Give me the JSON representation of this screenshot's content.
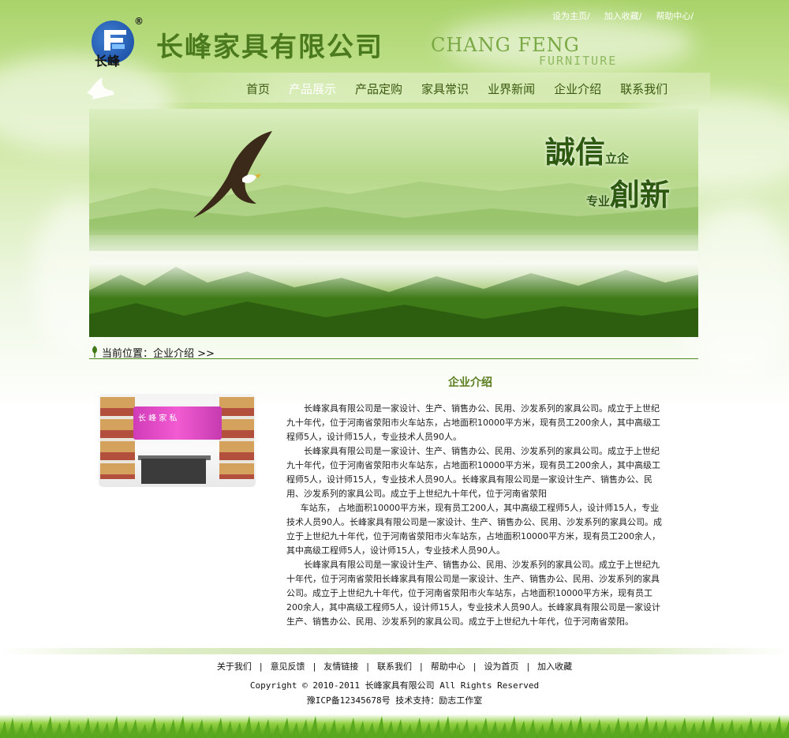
{
  "top_links": [
    "设为主页/",
    "加入收藏/",
    "帮助中心/"
  ],
  "logo": {
    "text": "长峰",
    "registered": "®"
  },
  "company_name": "长峰家具有限公司",
  "brand_en": {
    "line1": "CHANG FENG",
    "line2": "FURNITURE"
  },
  "nav": [
    "首页",
    "产品展示",
    "产品定购",
    "家具常识",
    "业界新闻",
    "企业介绍",
    "联系我们"
  ],
  "banner": {
    "slogan1_big": "誠信",
    "slogan1_small": "立企",
    "slogan2_small": "专业",
    "slogan2_big": "創新"
  },
  "breadcrumb": "当前位置：企业介绍 >>",
  "section_title": "企业介绍",
  "photo_sign": "长 峰 家 私",
  "article": [
    "长峰家具有限公司是一家设计、生产、销售办公、民用、沙发系列的家具公司。成立于上世纪九十年代，位于河南省荥阳市火车站东，占地面积10000平方米，现有员工200余人，其中高级工程师5人，设计师15人，专业技术人员90人。",
    "长峰家具有限公司是一家设计、生产、销售办公、民用、沙发系列的家具公司。成立于上世纪九十年代，位于河南省荥阳市火车站东，占地面积10000平方米，现有员工200余人，其中高级工程师5人，设计师15人，专业技术人员90人。长峰家具有限公司是一家设计生产、销售办公、民用、沙发系列的家具公司。成立于上世纪九十年代，位于河南省荥阳",
    "车站东， 占地面积10000平方米，现有员工200人，其中高级工程师5人，设计师15人，专业技术人员90人。长峰家具有限公司是一家设计、生产、销售办公、民用、沙发系列的家具公司。成立于上世纪九十年代，位于河南省荥阳市火车站东，占地面积10000平方米，现有员工200余人，其中高级工程师5人，设计师15人，专业技术人员90人。",
    "长峰家具有限公司是一家设计生产、销售办公、民用、沙发系列的家具公司。成立于上世纪九十年代，位于河南省荥阳长峰家具有限公司是一家设计、生产、销售办公、民用、沙发系列的家具公司。成立于上世纪九十年代，位于河南省荥阳市火车站东，占地面积10000平方米，现有员工200余人，其中高级工程师5人，设计师15人，专业技术人员90人。长峰家具有限公司是一家设计生产、销售办公、民用、沙发系列的家具公司。成立于上世纪九十年代，位于河南省荥阳。"
  ],
  "footer_links": [
    "关于我们",
    "意见反馈",
    "友情链接",
    "联系我们",
    "帮助中心",
    "设为首页",
    "加入收藏"
  ],
  "copyright": "Copyright © 2010-2011 长峰家具有限公司  All Rights Reserved",
  "icp": "豫ICP备12345678号   技术支持：励志工作室",
  "colors": {
    "accent_green": "#4b7a1e",
    "nav_text": "#3c5a12",
    "rule": "#4f8a22"
  }
}
